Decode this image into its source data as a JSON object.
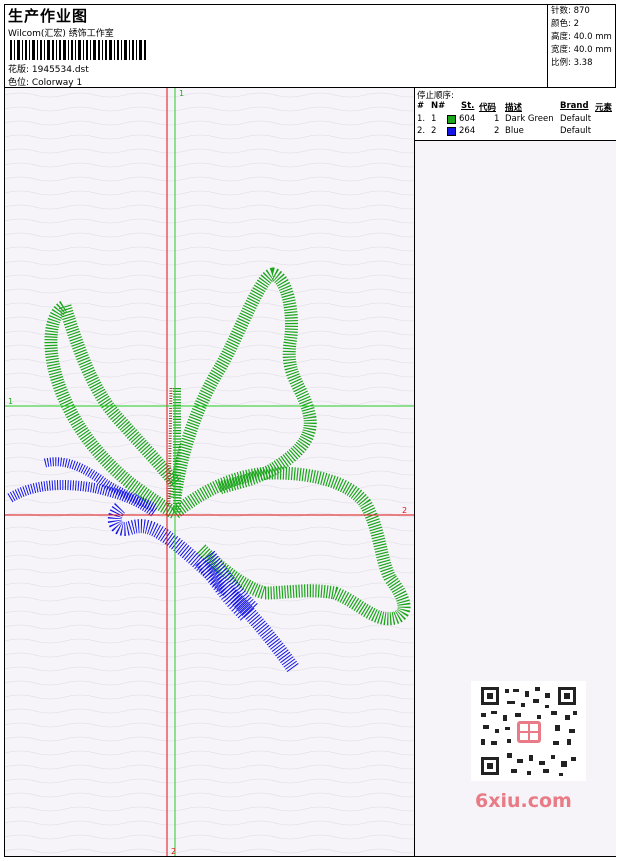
{
  "header": {
    "title": "生产作业图",
    "studio": "Wilcom(汇宏) 绣饰工作室",
    "design": "花版:  1945534.dst",
    "colorway": "色位:  Colorway 1"
  },
  "stats": {
    "stitches": "针数:  870",
    "colors": "颜色:  2",
    "height": "高度:  40.0 mm",
    "width": "宽度:  40.0 mm",
    "ratio": "比例:  3.38"
  },
  "guides": {
    "v_top_label": "1",
    "v_bottom_label": "2",
    "h_left_label": "1",
    "h_right_label": "2"
  },
  "stop_sequence": {
    "title": "停止顺序:",
    "headers": {
      "hash": "#",
      "n": "N#",
      "st": "St.",
      "code": "代码",
      "desc": "描述",
      "brand": "Brand",
      "elem": "元素"
    },
    "rows": [
      {
        "hash": "1.",
        "n": "1",
        "color": "#1aa51a",
        "st": "604",
        "code": "1",
        "desc": "Dark Green",
        "brand": "Default"
      },
      {
        "hash": "2.",
        "n": "2",
        "color": "#1414e6",
        "st": "264",
        "code": "2",
        "desc": "Blue",
        "brand": "Default"
      }
    ]
  },
  "colors": {
    "green_thread": "#1aa51a",
    "blue_thread": "#1414e6",
    "guide_green": "#22cc22",
    "guide_red": "#dd1111",
    "watermark": "#e87b85"
  },
  "watermark": {
    "text": "6xiu.com"
  }
}
